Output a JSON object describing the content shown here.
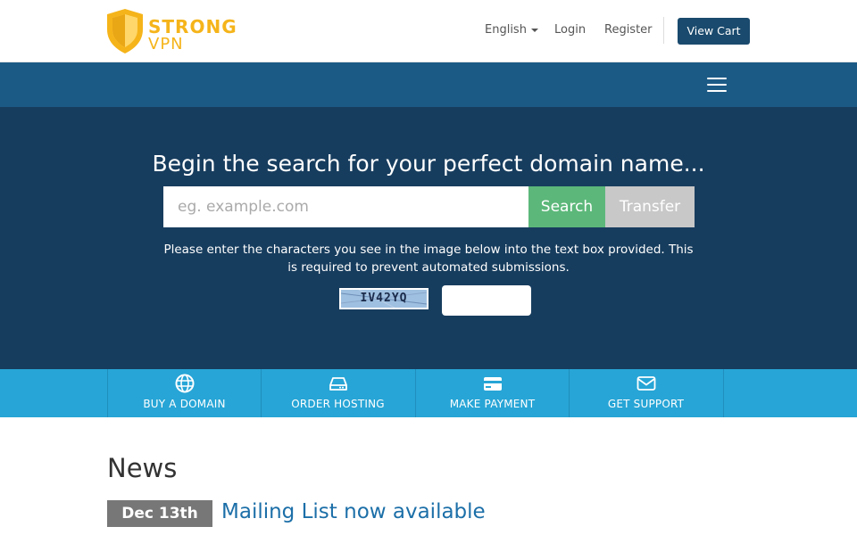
{
  "brand": {
    "line1": "STRONG",
    "line2": "VPN",
    "color": "#f5b41a"
  },
  "topnav": {
    "language": "English",
    "login": "Login",
    "register": "Register",
    "view_cart": "View Cart"
  },
  "hero": {
    "title": "Begin the search for your perfect domain name...",
    "search_placeholder": "eg. example.com",
    "search_button": "Search",
    "transfer_button": "Transfer",
    "captcha_prompt": "Please enter the characters you see in the image below into the text box provided. This is required to prevent automated submissions.",
    "captcha_code": "IV42YQ"
  },
  "quick_links": [
    {
      "label": "BUY A DOMAIN",
      "icon": "globe-icon"
    },
    {
      "label": "ORDER HOSTING",
      "icon": "hdd-icon"
    },
    {
      "label": "MAKE PAYMENT",
      "icon": "credit-card-icon"
    },
    {
      "label": "GET SUPPORT",
      "icon": "envelope-icon"
    }
  ],
  "news": {
    "heading": "News",
    "items": [
      {
        "date": "Dec 13th",
        "title": "Mailing List now available"
      }
    ]
  },
  "colors": {
    "header_bg": "#ffffff",
    "navband_bg": "#1c5a86",
    "hero_bg": "#173d5e",
    "search_green": "#5cb87a",
    "transfer_gray": "#c8c8c8",
    "quickbar_bg": "#27a5d6",
    "cart_button": "#1a4a6d",
    "link_blue": "#1c6fa8"
  }
}
